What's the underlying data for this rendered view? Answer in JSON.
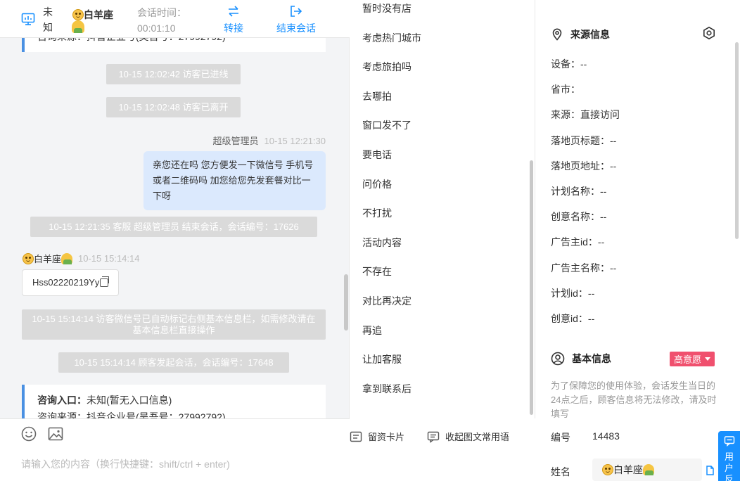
{
  "header": {
    "visitor_unknown": "未知",
    "visitor_name": "白羊座",
    "session_time_label": "会话时间：",
    "session_time": "00:01:10",
    "transfer": "转接",
    "end_session": "结束会话"
  },
  "messages": {
    "top_card_partial": "咨询来源：抖音企业号(吴吾号：27992792)",
    "sys1": "10-15 12:02:42 访客已进线",
    "sys2": "10-15 12:02:48 访客已离开",
    "agent_name": "超级管理员",
    "agent_time": "10-15 12:21:30",
    "agent_text": "亲您还在吗 您方便发一下微信号 手机号或者二维码吗 加您给您先发套餐对比一下呀",
    "sys3": "10-15 12:21:35 客服 超级管理员 结束会话，会话编号：17626",
    "customer_name": "白羊座",
    "customer_time": "10-15 15:14:14",
    "customer_text": "Hss02220219Yy",
    "sys4": "10-15 15:14:14 访客微信号已自动标记右侧基本信息栏，如需修改请在基本信息栏直接操作",
    "sys5": "10-15 15:14:14 顾客发起会话，会话编号：17648",
    "card_entry_label": "咨询入口：",
    "card_entry_value": "未知(暂无入口信息)",
    "card_source_partial": "咨询来源：抖音企业号(吴吾号：27992792)"
  },
  "input": {
    "placeholder": "请输入您的内容（换行快捷键：shift/ctrl + enter)"
  },
  "quick_replies": {
    "items": [
      "暂时没有店",
      "考虑热门城市",
      "考虑旅拍吗",
      "去哪拍",
      "窗口发不了",
      "要电话",
      "问价格",
      "不打扰",
      "活动内容",
      "不存在",
      "对比再决定",
      "再追",
      "让加客服",
      "拿到联系后"
    ],
    "leave_card": "留资卡片",
    "collapse_phrases": "收起图文常用语"
  },
  "source_info": {
    "title": "来源信息",
    "rows": [
      {
        "label": "设备：",
        "value": "--"
      },
      {
        "label": "省市：",
        "value": ""
      },
      {
        "label": "来源：",
        "value": "直接访问"
      },
      {
        "label": "落地页标题：",
        "value": "--"
      },
      {
        "label": "落地页地址：",
        "value": "--"
      },
      {
        "label": "计划名称：",
        "value": "--"
      },
      {
        "label": "创意名称：",
        "value": "--"
      },
      {
        "label": "广告主id：",
        "value": "--"
      },
      {
        "label": "广告主名称：",
        "value": "--"
      },
      {
        "label": "计划id：",
        "value": "--"
      },
      {
        "label": "创意id：",
        "value": "--"
      }
    ]
  },
  "basic_info": {
    "title": "基本信息",
    "intent_badge": "高意愿",
    "note": "为了保障您的使用体验，会话发生当日的24点之后，顾客信息将无法修改，请及时填写",
    "id_label": "编号",
    "id_value": "14483",
    "name_label": "姓名",
    "name_value": "白羊座"
  },
  "side_tab": {
    "label": "用户反馈"
  },
  "colors": {
    "accent": "#1890ff",
    "badge": "#f0506e",
    "agent_bubble": "#dbe9fd",
    "system_pill": "#dadada"
  }
}
